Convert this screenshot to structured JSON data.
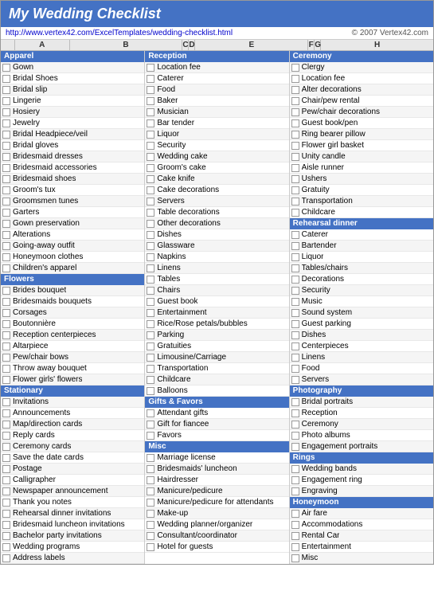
{
  "title": "My Wedding Checklist",
  "url": "http://www.vertex42.com/ExcelTemplates/wedding-checklist.html",
  "copyright": "© 2007 Vertex42.com",
  "columns": [
    "A",
    "B",
    "C",
    "D",
    "E",
    "F",
    "G",
    "H"
  ],
  "col1": {
    "sections": [
      {
        "header": "Apparel",
        "items": [
          "Gown",
          "Bridal Shoes",
          "Bridal slip",
          "Lingerie",
          "Hosiery",
          "Jewelry",
          "Bridal Headpiece/veil",
          "Bridal gloves",
          "Bridesmaid dresses",
          "Bridesmaid accessories",
          "Bridesmaid shoes",
          "Groom's tux",
          "Groomsmen tunes",
          "Garters",
          "Gown preservation",
          "Alterations",
          "Going-away outfit",
          "Honeymoon clothes",
          "Children's apparel"
        ]
      },
      {
        "header": "Flowers",
        "items": [
          "Brides bouquet",
          "Bridesmaids bouquets",
          "Corsages",
          "Boutonnière",
          "Reception centerpieces",
          "Altarpiece",
          "Pew/chair bows",
          "Throw away bouquet",
          "Flower girls' flowers"
        ]
      },
      {
        "header": "Stationary",
        "items": [
          "Invitations",
          "Announcements",
          "Map/direction cards",
          "Reply cards",
          "Ceremony cards",
          "Save the date cards",
          "Postage",
          "Calligrapher",
          "Newspaper announcement",
          "Thank you notes",
          "Rehearsal dinner invitations",
          "Bridesmaid luncheon invitations",
          "Bachelor party invitations",
          "Wedding programs",
          "Address labels"
        ]
      }
    ]
  },
  "col2": {
    "sections": [
      {
        "header": "Reception",
        "items": [
          "Location fee",
          "Caterer",
          "Food",
          "Baker",
          "Musician",
          "Bar tender",
          "Liquor",
          "Security",
          "Wedding cake",
          "Groom's cake",
          "Cake knife",
          "Cake decorations",
          "Servers",
          "Table decorations",
          "Other decorations",
          "Dishes",
          "Glassware",
          "Napkins",
          "Linens",
          "Tables",
          "Chairs",
          "Guest book",
          "Entertainment",
          "Rice/Rose petals/bubbles",
          "Parking",
          "Gratuities",
          "Limousine/Carriage",
          "Transportation",
          "Childcare",
          "Balloons"
        ]
      },
      {
        "header": "Gifts & Favors",
        "items": [
          "Attendant gifts",
          "Gift for fiancee",
          "Favors"
        ]
      },
      {
        "header": "Misc",
        "items": [
          "Marriage license",
          "Bridesmaids' luncheon",
          "Hairdresser",
          "Manicure/pedicure",
          "Manicure/pedicure for attendants",
          "Make-up",
          "Wedding planner/organizer",
          "Consultant/coordinator",
          "Hotel for guests"
        ]
      }
    ]
  },
  "col3": {
    "sections": [
      {
        "header": "Ceremony",
        "items": [
          "Clergy",
          "Location fee",
          "Alter decorations",
          "Chair/pew rental",
          "Pew/chair decorations",
          "Guest book/pen",
          "Ring bearer pillow",
          "Flower girl basket",
          "Unity candle",
          "Aisle runner",
          "Ushers",
          "Gratuity",
          "Transportation",
          "Childcare"
        ]
      },
      {
        "header": "Rehearsal dinner",
        "items": [
          "Caterer",
          "Bartender",
          "Liquor",
          "Tables/chairs",
          "Decorations",
          "Security",
          "Music",
          "Sound system",
          "Guest parking",
          "Dishes",
          "Centerpieces",
          "Linens",
          "Food",
          "Servers"
        ]
      },
      {
        "header": "Photography",
        "items": [
          "Bridal portraits",
          "Reception",
          "Ceremony",
          "Photo albums",
          "Engagement portraits"
        ]
      },
      {
        "header": "Rings",
        "items": [
          "Wedding bands",
          "Engagement ring",
          "Engraving"
        ]
      },
      {
        "header": "Honeymoon",
        "items": [
          "Air fare",
          "Accommodations",
          "Rental Car",
          "Entertainment",
          "Misc"
        ]
      }
    ]
  }
}
